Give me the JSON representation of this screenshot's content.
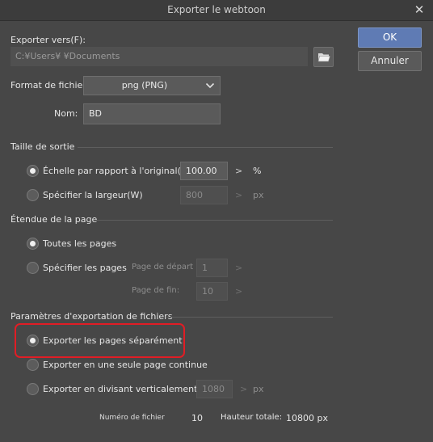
{
  "window": {
    "title": "Exporter le webtoon",
    "close_glyph": "✕"
  },
  "export_to": {
    "label": "Exporter vers(F):",
    "path": "C:¥Users¥           ¥Documents"
  },
  "format": {
    "label": "Format de fichier:",
    "selected": "png (PNG)"
  },
  "name": {
    "label": "Nom:",
    "value": "BD"
  },
  "output_size": {
    "section_title": "Taille de sortie",
    "scale_option": {
      "label": "Échelle par rapport à l'original(Z)",
      "value": "100.00",
      "unit": "%",
      "checked": true
    },
    "width_option": {
      "label": "Spécifier la largeur(W)",
      "value": "800",
      "unit": "px",
      "checked": false
    }
  },
  "page_range": {
    "section_title": "Étendue de la page",
    "all_pages": {
      "label": "Toutes les pages",
      "checked": true
    },
    "specify_pages": {
      "label": "Spécifier les pages",
      "checked": false
    },
    "start_label": "Page de départ",
    "start_value": "1",
    "end_label": "Page de fin:",
    "end_value": "10"
  },
  "export_params": {
    "section_title": "Paramètres d'exportation de fichiers",
    "separate": {
      "label": "Exporter les pages séparément",
      "checked": true
    },
    "continuous": {
      "label": "Exporter en une seule page continue",
      "checked": false
    },
    "vertical_split": {
      "label": "Exporter en divisant verticalement",
      "value": "1080",
      "unit": "px",
      "checked": false
    }
  },
  "summary": {
    "file_count_label": "Numéro de fichier",
    "file_count": "10",
    "total_height_label": "Hauteur totale:",
    "total_height": "10800 px"
  },
  "buttons": {
    "ok": "OK",
    "cancel": "Annuler"
  },
  "colors": {
    "ok_button": "#5f7bb4",
    "highlight": "#e11d25",
    "background": "#474747"
  },
  "icons": {
    "folder": "folder-icon",
    "chevron": "chevron-down-icon",
    "close": "close-icon"
  }
}
